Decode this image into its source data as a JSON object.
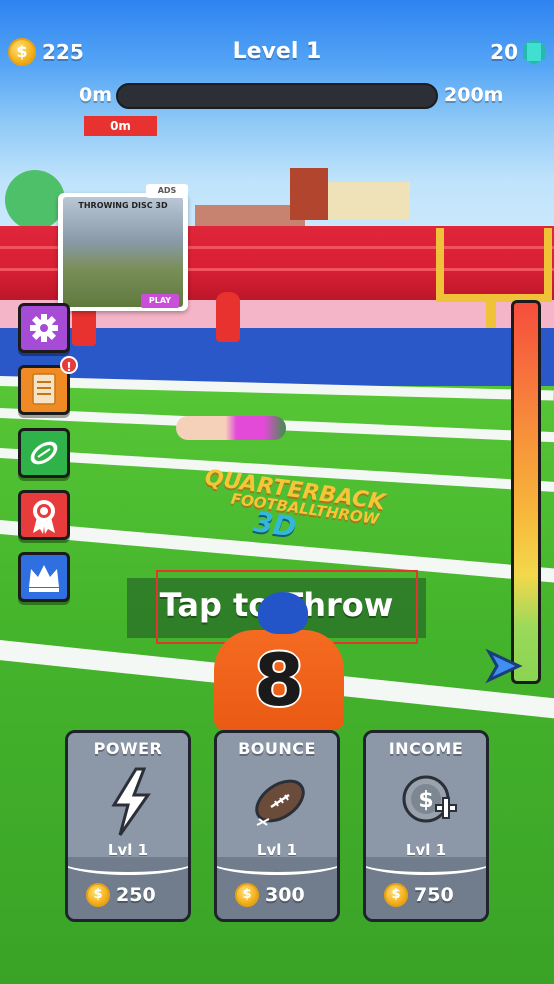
{
  "hud": {
    "coins": "225",
    "level_title": "Level 1",
    "gems": "20",
    "coin_glyph": "$"
  },
  "progress": {
    "start_label": "0m",
    "end_label": "200m",
    "current_label": "0m",
    "value": 0
  },
  "ad": {
    "tag": "ADS",
    "title": "THROWING DISC 3D",
    "play_label": "PLAY"
  },
  "side_menu": {
    "items": [
      {
        "name": "settings",
        "color": "#a54bd6",
        "icon": "gear-icon"
      },
      {
        "name": "tasks",
        "color": "#f08a24",
        "icon": "clipboard-icon",
        "badge": "!"
      },
      {
        "name": "balls",
        "color": "#2fb24a",
        "icon": "football-icon"
      },
      {
        "name": "rewards",
        "color": "#e83b3b",
        "icon": "ribbon-icon"
      },
      {
        "name": "vip",
        "color": "#2f6fe0",
        "icon": "crown-icon"
      }
    ]
  },
  "logo": {
    "line1": "QUARTERBACK",
    "line2": "FOOTBALLTHROW",
    "line3": "3D"
  },
  "player": {
    "number": "8"
  },
  "tap_prompt": "Tap to Throw",
  "upgrades": [
    {
      "title": "POWER",
      "level": "Lvl 1",
      "price": "250",
      "icon": "lightning-icon"
    },
    {
      "title": "BOUNCE",
      "level": "Lvl 1",
      "price": "300",
      "icon": "football-icon"
    },
    {
      "title": "INCOME",
      "level": "Lvl 1",
      "price": "750",
      "icon": "coin-plus-icon"
    }
  ],
  "colors": {
    "accent_red": "#e83b3b",
    "progress_fill": "#f9c02a",
    "card_gray": "#7d8a9a"
  }
}
